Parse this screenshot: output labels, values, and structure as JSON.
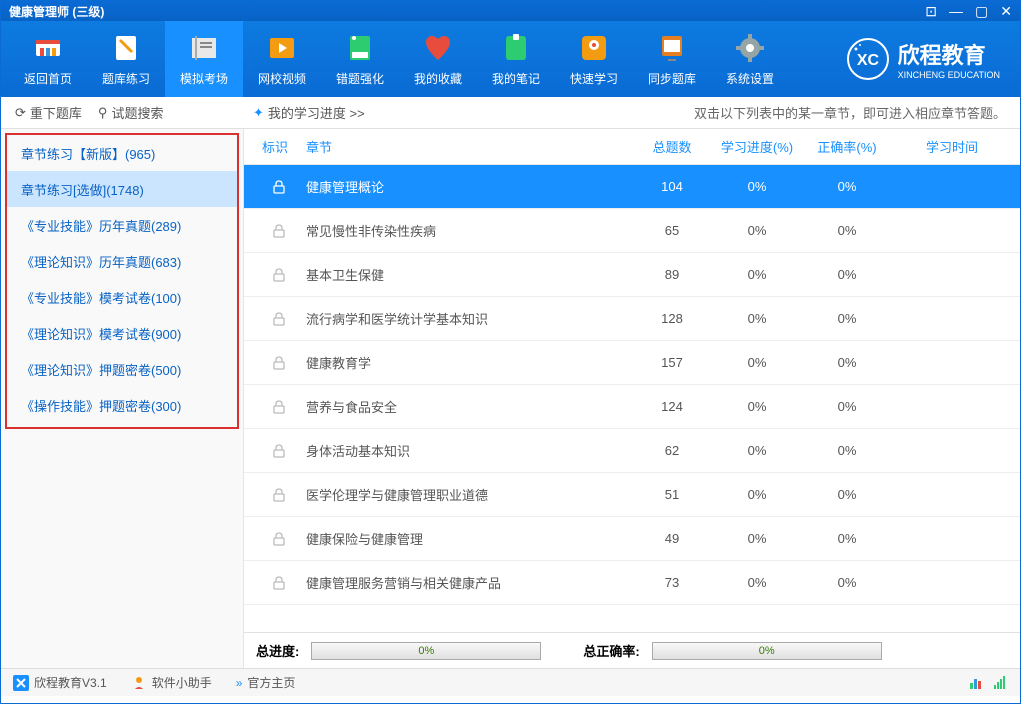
{
  "titlebar": {
    "title": "健康管理师 (三级)"
  },
  "toolbar": {
    "items": [
      {
        "label": "返回首页",
        "icon": "home"
      },
      {
        "label": "题库练习",
        "icon": "practice"
      },
      {
        "label": "模拟考场",
        "icon": "exam"
      },
      {
        "label": "网校视频",
        "icon": "video"
      },
      {
        "label": "错题强化",
        "icon": "errors"
      },
      {
        "label": "我的收藏",
        "icon": "favorite"
      },
      {
        "label": "我的笔记",
        "icon": "notes"
      },
      {
        "label": "快速学习",
        "icon": "quick"
      },
      {
        "label": "同步题库",
        "icon": "sync"
      },
      {
        "label": "系统设置",
        "icon": "settings"
      }
    ],
    "brand": {
      "main": "欣程教育",
      "sub": "XINCHENG EDUCATION"
    }
  },
  "sub_toolbar": {
    "reload": "重下题库",
    "search": "试题搜索",
    "progress": "我的学习进度 >>",
    "tip": "双击以下列表中的某一章节，即可进入相应章节答题。"
  },
  "sidebar": {
    "items": [
      "章节练习【新版】(965)",
      "章节练习[选做](1748)",
      "《专业技能》历年真题(289)",
      "《理论知识》历年真题(683)",
      "《专业技能》模考试卷(100)",
      "《理论知识》模考试卷(900)",
      "《理论知识》押题密卷(500)",
      "《操作技能》押题密卷(300)"
    ]
  },
  "table": {
    "headers": {
      "sign": "标识",
      "chapter": "章节",
      "total": "总题数",
      "progress": "学习进度(%)",
      "accuracy": "正确率(%)",
      "time": "学习时间"
    },
    "rows": [
      {
        "chapter": "健康管理概论",
        "total": "104",
        "progress": "0%",
        "accuracy": "0%"
      },
      {
        "chapter": "常见慢性非传染性疾病",
        "total": "65",
        "progress": "0%",
        "accuracy": "0%"
      },
      {
        "chapter": "基本卫生保健",
        "total": "89",
        "progress": "0%",
        "accuracy": "0%"
      },
      {
        "chapter": "流行病学和医学统计学基本知识",
        "total": "128",
        "progress": "0%",
        "accuracy": "0%"
      },
      {
        "chapter": "健康教育学",
        "total": "157",
        "progress": "0%",
        "accuracy": "0%"
      },
      {
        "chapter": "营养与食品安全",
        "total": "124",
        "progress": "0%",
        "accuracy": "0%"
      },
      {
        "chapter": "身体活动基本知识",
        "total": "62",
        "progress": "0%",
        "accuracy": "0%"
      },
      {
        "chapter": "医学伦理学与健康管理职业道德",
        "total": "51",
        "progress": "0%",
        "accuracy": "0%"
      },
      {
        "chapter": "健康保险与健康管理",
        "total": "49",
        "progress": "0%",
        "accuracy": "0%"
      },
      {
        "chapter": "健康管理服务营销与相关健康产品",
        "total": "73",
        "progress": "0%",
        "accuracy": "0%"
      }
    ]
  },
  "summary": {
    "total_progress_label": "总进度:",
    "total_progress": "0%",
    "total_accuracy_label": "总正确率:",
    "total_accuracy": "0%"
  },
  "statusbar": {
    "app": "欣程教育V3.1",
    "helper": "软件小助手",
    "homepage": "官方主页"
  }
}
